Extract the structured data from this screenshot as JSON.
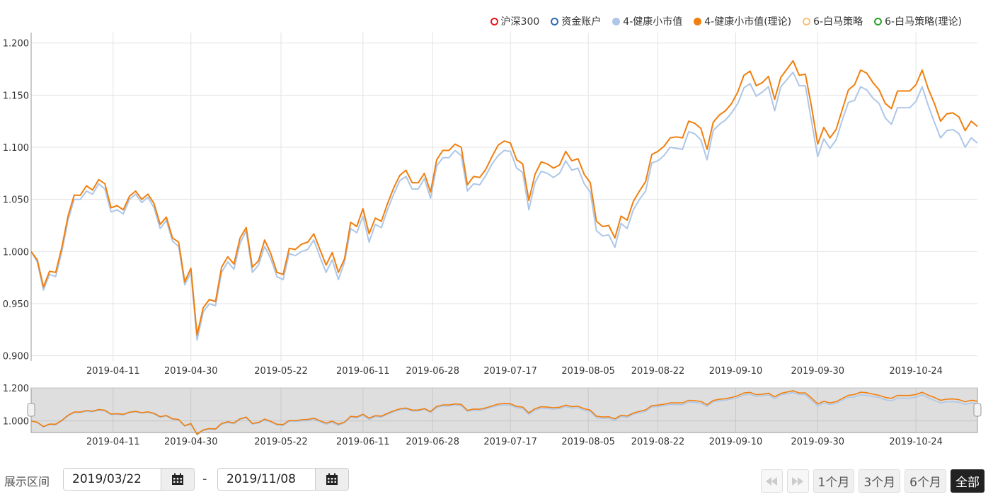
{
  "legend": [
    {
      "label": "沪深300",
      "color": "#e8191d",
      "style": "hollow"
    },
    {
      "label": "资金账户",
      "color": "#2e6db1",
      "style": "hollow"
    },
    {
      "label": "4-健康小市值",
      "color": "#aec7e8",
      "style": "filled"
    },
    {
      "label": "4-健康小市值(理论)",
      "color": "#f07f0e",
      "style": "filled"
    },
    {
      "label": "6-白马策略",
      "color": "#f8c07a",
      "style": "hollow"
    },
    {
      "label": "6-白马策略(理论)",
      "color": "#2ca02c",
      "style": "hollow"
    }
  ],
  "controls": {
    "range_label": "展示区间",
    "start_date": "2019/03/22",
    "end_date": "2019/11/08",
    "separator": "-",
    "calendar_icon": "calendar-icon",
    "prev_icon": "double-left-icon",
    "next_icon": "double-right-icon",
    "periods": [
      "1个月",
      "3个月",
      "6个月",
      "全部"
    ],
    "active_period": "全部"
  },
  "chart_data": {
    "type": "line",
    "x_start": "2019-03-22",
    "x_end": "2019-11-08",
    "x_ticks": [
      "2019-04-11",
      "2019-04-30",
      "2019-05-22",
      "2019-06-11",
      "2019-06-28",
      "2019-07-17",
      "2019-08-05",
      "2019-08-22",
      "2019-09-10",
      "2019-09-30",
      "2019-10-24"
    ],
    "y_ticks": [
      "0.900",
      "0.950",
      "1.000",
      "1.050",
      "1.100",
      "1.150",
      "1.200"
    ],
    "ylim": [
      0.895,
      1.21
    ],
    "navigator_ylim": [
      0.93,
      1.2
    ],
    "navigator_y_ticks": [
      "1.000",
      "1.200"
    ],
    "grid": true,
    "legend_position": "top-right",
    "series": [
      {
        "name": "4-健康小市值",
        "color": "#aec7e8",
        "values": [
          1.0,
          0.99,
          0.963,
          0.978,
          0.976,
          1.0,
          1.03,
          1.05,
          1.05,
          1.058,
          1.055,
          1.065,
          1.06,
          1.038,
          1.04,
          1.036,
          1.05,
          1.055,
          1.047,
          1.052,
          1.042,
          1.022,
          1.03,
          1.01,
          1.005,
          0.968,
          0.98,
          0.915,
          0.942,
          0.95,
          0.948,
          0.98,
          0.99,
          0.983,
          1.008,
          1.02,
          0.98,
          0.987,
          1.005,
          0.993,
          0.976,
          0.973,
          0.998,
          0.996,
          1.0,
          1.002,
          1.011,
          0.995,
          0.98,
          0.992,
          0.973,
          0.99,
          1.022,
          1.018,
          1.034,
          1.009,
          1.026,
          1.023,
          1.04,
          1.055,
          1.068,
          1.072,
          1.06,
          1.06,
          1.07,
          1.051,
          1.082,
          1.09,
          1.09,
          1.097,
          1.092,
          1.058,
          1.065,
          1.064,
          1.073,
          1.084,
          1.092,
          1.097,
          1.096,
          1.08,
          1.076,
          1.04,
          1.066,
          1.077,
          1.075,
          1.071,
          1.075,
          1.087,
          1.078,
          1.08,
          1.065,
          1.057,
          1.02,
          1.015,
          1.016,
          1.004,
          1.027,
          1.022,
          1.04,
          1.05,
          1.058,
          1.085,
          1.087,
          1.092,
          1.1,
          1.099,
          1.098,
          1.115,
          1.113,
          1.107,
          1.088,
          1.116,
          1.122,
          1.126,
          1.133,
          1.142,
          1.157,
          1.161,
          1.149,
          1.153,
          1.158,
          1.135,
          1.158,
          1.165,
          1.172,
          1.159,
          1.159,
          1.125,
          1.091,
          1.108,
          1.099,
          1.107,
          1.126,
          1.143,
          1.145,
          1.158,
          1.155,
          1.147,
          1.142,
          1.128,
          1.122,
          1.138,
          1.138,
          1.138,
          1.144,
          1.158,
          1.14,
          1.124,
          1.109,
          1.116,
          1.117,
          1.113,
          1.1,
          1.109,
          1.104
        ]
      },
      {
        "name": "4-健康小市值(理论)",
        "color": "#f07f0e",
        "values": [
          1.0,
          0.992,
          0.966,
          0.981,
          0.98,
          1.004,
          1.034,
          1.054,
          1.054,
          1.063,
          1.059,
          1.069,
          1.065,
          1.042,
          1.044,
          1.04,
          1.053,
          1.058,
          1.05,
          1.055,
          1.046,
          1.026,
          1.033,
          1.013,
          1.009,
          0.971,
          0.984,
          0.92,
          0.946,
          0.954,
          0.952,
          0.985,
          0.995,
          0.988,
          1.013,
          1.023,
          0.985,
          0.991,
          1.011,
          0.998,
          0.98,
          0.978,
          1.003,
          1.002,
          1.007,
          1.009,
          1.017,
          1.002,
          0.987,
          0.999,
          0.98,
          0.993,
          1.028,
          1.024,
          1.041,
          1.017,
          1.032,
          1.029,
          1.046,
          1.061,
          1.073,
          1.078,
          1.066,
          1.066,
          1.075,
          1.057,
          1.088,
          1.097,
          1.097,
          1.103,
          1.1,
          1.064,
          1.072,
          1.071,
          1.079,
          1.091,
          1.102,
          1.106,
          1.104,
          1.088,
          1.084,
          1.049,
          1.074,
          1.086,
          1.084,
          1.08,
          1.083,
          1.096,
          1.087,
          1.089,
          1.074,
          1.066,
          1.029,
          1.024,
          1.025,
          1.013,
          1.034,
          1.03,
          1.048,
          1.058,
          1.067,
          1.093,
          1.096,
          1.101,
          1.109,
          1.11,
          1.109,
          1.125,
          1.123,
          1.118,
          1.098,
          1.124,
          1.131,
          1.135,
          1.142,
          1.153,
          1.169,
          1.173,
          1.159,
          1.162,
          1.168,
          1.146,
          1.167,
          1.175,
          1.183,
          1.169,
          1.17,
          1.139,
          1.103,
          1.119,
          1.109,
          1.117,
          1.136,
          1.155,
          1.16,
          1.174,
          1.171,
          1.162,
          1.155,
          1.142,
          1.137,
          1.154,
          1.154,
          1.154,
          1.16,
          1.174,
          1.156,
          1.142,
          1.125,
          1.132,
          1.133,
          1.129,
          1.116,
          1.125,
          1.12
        ]
      }
    ]
  }
}
